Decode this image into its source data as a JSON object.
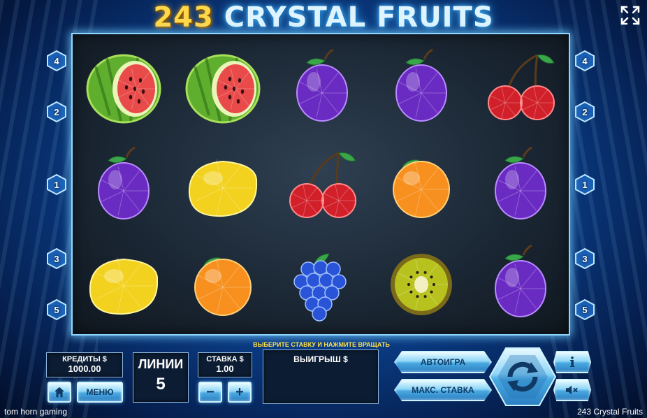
{
  "title": {
    "number": "243",
    "text": "CRYSTAL FRUITS"
  },
  "icons": {
    "expand": "expand-arrows-icon",
    "home": "home-icon",
    "info": "info-icon",
    "sound": "sound-muted-icon",
    "spin": "spin-arrows-icon"
  },
  "reels": [
    [
      "watermelon",
      "plum",
      "lemon"
    ],
    [
      "watermelon",
      "lemon",
      "orange"
    ],
    [
      "plum",
      "cherry",
      "grapes"
    ],
    [
      "plum",
      "orange",
      "kiwi"
    ],
    [
      "cherry",
      "plum",
      "plum"
    ]
  ],
  "paylines_left": [
    "4",
    "2",
    "1",
    "3",
    "5"
  ],
  "paylines_right": [
    "4",
    "2",
    "1",
    "3",
    "5"
  ],
  "credits": {
    "label": "КРЕДИТЫ $",
    "value": "1000.00"
  },
  "lines": {
    "label": "ЛИНИИ",
    "value": "5"
  },
  "bet": {
    "label": "СТАВКА $",
    "value": "1.00",
    "minus": "−",
    "plus": "+"
  },
  "menu_label": "МЕНЮ",
  "hint": "ВЫБЕРИТЕ СТАВКУ И НАЖМИТЕ ВРАЩАТЬ",
  "win": {
    "label": "ВЫИГРЫШ $",
    "value": ""
  },
  "autoplay_label": "АВТОИГРА",
  "maxbet_label": "МАКС. СТАВКА",
  "info_label": "i",
  "footer": {
    "left": "tom horn gaming",
    "right": "243 Crystal Fruits"
  },
  "colors": {
    "accent": "#8fd6ff",
    "gold": "#ffd84a",
    "panel": "#0c1d33"
  }
}
